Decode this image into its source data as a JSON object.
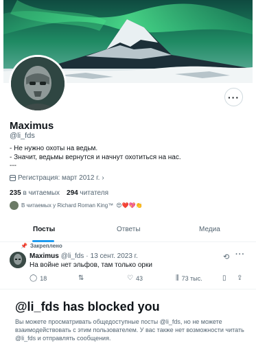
{
  "profile": {
    "name": "Maximus",
    "handle": "@li_fds",
    "bio_lines": [
      "- Не нужно охоты на ведьм.",
      "- Значит, ведьмы вернутся и начнут охотиться на нас.",
      "---"
    ],
    "joined": "Регистрация: март 2012 г.",
    "following_count": "235",
    "following_label": "в читаемых",
    "followers_count": "294",
    "followers_label": "читателя",
    "known_followers": "В читаемых у Richard Roman King™",
    "known_emoji": "😍❤️💖👏"
  },
  "more_icon": "more-horizontal-icon",
  "tabs": [
    {
      "label": "Посты",
      "active": true
    },
    {
      "label": "Ответы",
      "active": false
    },
    {
      "label": "Медиа",
      "active": false
    }
  ],
  "pinned_label": "Закреплено",
  "tweet": {
    "name": "Maximus",
    "handle": "@li_fds",
    "separator": "·",
    "date": "13 сент. 2023 г.",
    "text": "На войне нет эльфов, там только орки",
    "replies": "18",
    "reposts": "",
    "likes": "43",
    "views": "73 тыс."
  },
  "blocked": {
    "title": "@li_fds has blocked you",
    "text": "Вы можете просматривать общедоступные посты @li_fds, но не можете взаимодействовать с этим пользователем. У вас также нет возможности читать @li_fds и отправлять сообщения."
  },
  "colors": {
    "accent": "#1d9bf0",
    "text_primary": "#0f1419",
    "text_secondary": "#536471",
    "border": "#eff3f4"
  }
}
